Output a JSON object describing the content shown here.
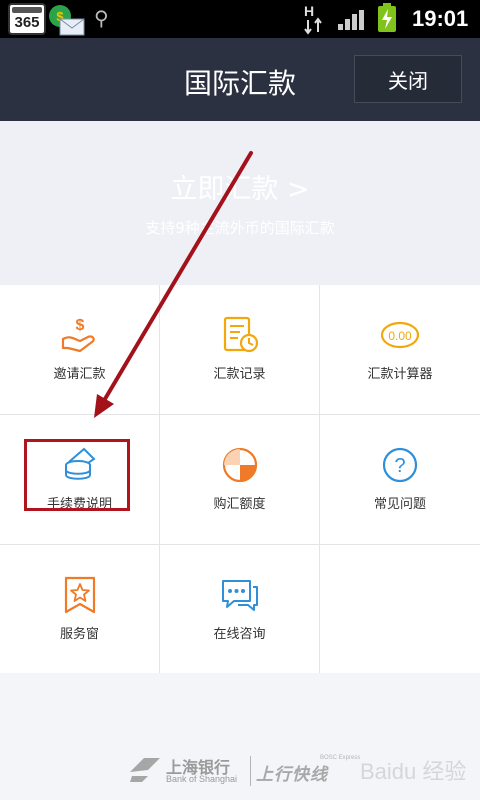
{
  "status_bar": {
    "app_badge": "365",
    "network_type": "H",
    "time": "19:01",
    "icons": [
      "app-365-icon",
      "mail-icon",
      "usb-icon",
      "network-h-icon",
      "signal-icon",
      "battery-charging-icon"
    ]
  },
  "header": {
    "title": "国际汇款",
    "close_label": "关闭"
  },
  "banner": {
    "title": "立即汇款 >",
    "subtitle": "支持9种主流外币的国际汇款"
  },
  "grid": [
    {
      "label": "邀请汇款",
      "icon": "hand-coin-icon"
    },
    {
      "label": "汇款记录",
      "icon": "record-clock-icon"
    },
    {
      "label": "汇款计算器",
      "icon": "calculator-0.00-icon",
      "icon_text": "0.00"
    },
    {
      "label": "手续费说明",
      "icon": "coin-stack-icon"
    },
    {
      "label": "购汇额度",
      "icon": "pie-chart-icon"
    },
    {
      "label": "常见问题",
      "icon": "question-icon",
      "icon_text": "?"
    },
    {
      "label": "服务窗",
      "icon": "star-bookmark-icon"
    },
    {
      "label": "在线咨询",
      "icon": "chat-bubbles-icon"
    }
  ],
  "footer": {
    "bank_name_cn": "上海银行",
    "bank_name_en": "Bank of Shanghai",
    "brand": "上行快线",
    "brand_sub": "BOSC Express",
    "watermark": "Baidu 经验"
  },
  "colors": {
    "header_bg": "#2b3140",
    "accent_orange": "#ef7a27",
    "icon_yellow": "#f2a80c",
    "icon_blue": "#2f8fd8",
    "highlight_red": "#b0141c"
  }
}
